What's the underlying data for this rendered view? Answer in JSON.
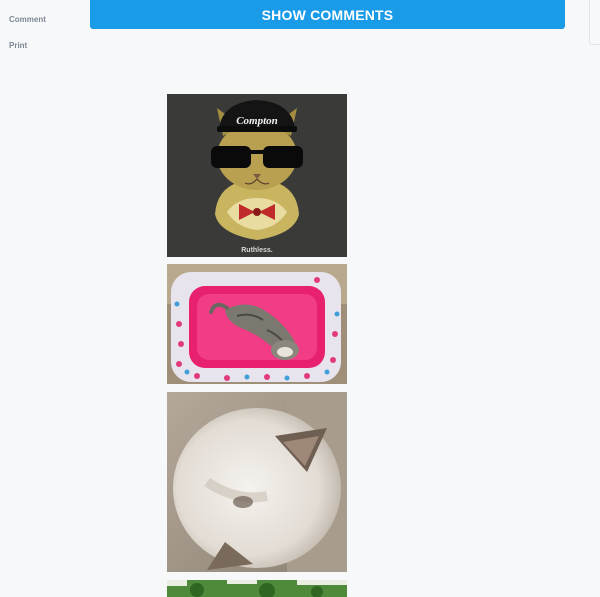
{
  "sidebar": {
    "comment_label": "Comment",
    "print_label": "Print"
  },
  "comments": {
    "show_label": "SHOW COMMENTS"
  },
  "photos": {
    "cap_text": "Compton",
    "shirt_text": "Ruthless."
  },
  "colors": {
    "accent": "#1a9be8",
    "background": "#f7f8fa",
    "link_gray": "#7d8794"
  }
}
